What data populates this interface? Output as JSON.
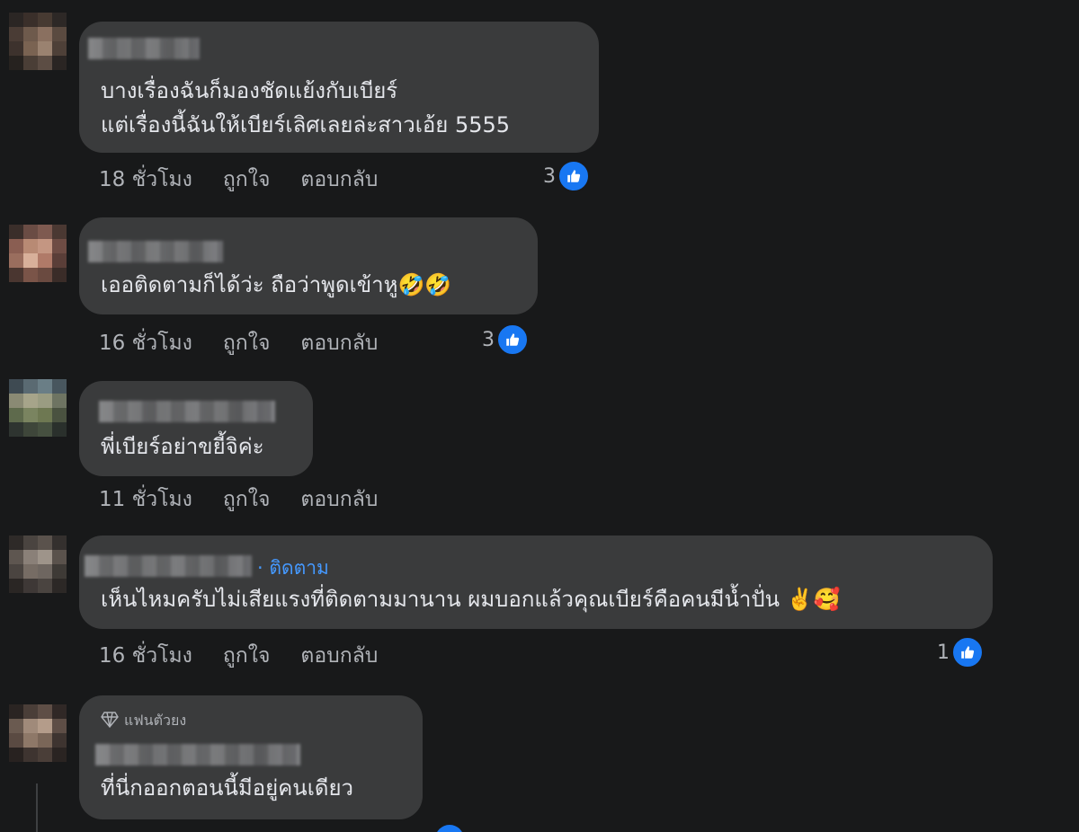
{
  "comments": [
    {
      "text_lines": [
        "บางเรื่องฉันก็มองชัดแย้งกับเบียร์",
        "แต่เรื่องนี้ฉันให้เบียร์เลิศเลยล่ะสาวเอ้ย 5555"
      ],
      "time": "18 ชั่วโมง",
      "like_label": "ถูกใจ",
      "reply_label": "ตอบกลับ",
      "reaction_count": "3"
    },
    {
      "text": "เออติดตามก็ได้ว่ะ ถือว่าพูดเข้าหู",
      "emoji": "🤣🤣",
      "time": "16 ชั่วโมง",
      "like_label": "ถูกใจ",
      "reply_label": "ตอบกลับ",
      "reaction_count": "3"
    },
    {
      "text": "พี่เบียร์อย่าขยี้จิค่ะ",
      "time": "11 ชั่วโมง",
      "like_label": "ถูกใจ",
      "reply_label": "ตอบกลับ"
    },
    {
      "follow_label": "· ติดตาม",
      "text": "เห็นไหมครับไม่เสียแรงที่ติดตามมานาน ผมบอกแล้วคุณเบียร์คือคนมีน้ำปั่น",
      "emoji": "✌️🥰",
      "time": "16 ชั่วโมง",
      "like_label": "ถูกใจ",
      "reply_label": "ตอบกลับ",
      "reaction_count": "1"
    },
    {
      "badge": "แฟนตัวยง",
      "text": "ที่นี่กออกตอนนี้มีอยู่คนเดียว"
    }
  ],
  "icons": {
    "like": "thumbs-up-icon",
    "badge": "diamond-icon"
  },
  "colors": {
    "background": "#18191a",
    "bubble": "#3a3b3c",
    "text": "#e4e6eb",
    "secondary": "#b0b3b8",
    "accent": "#1877f2",
    "link": "#4599ff"
  }
}
